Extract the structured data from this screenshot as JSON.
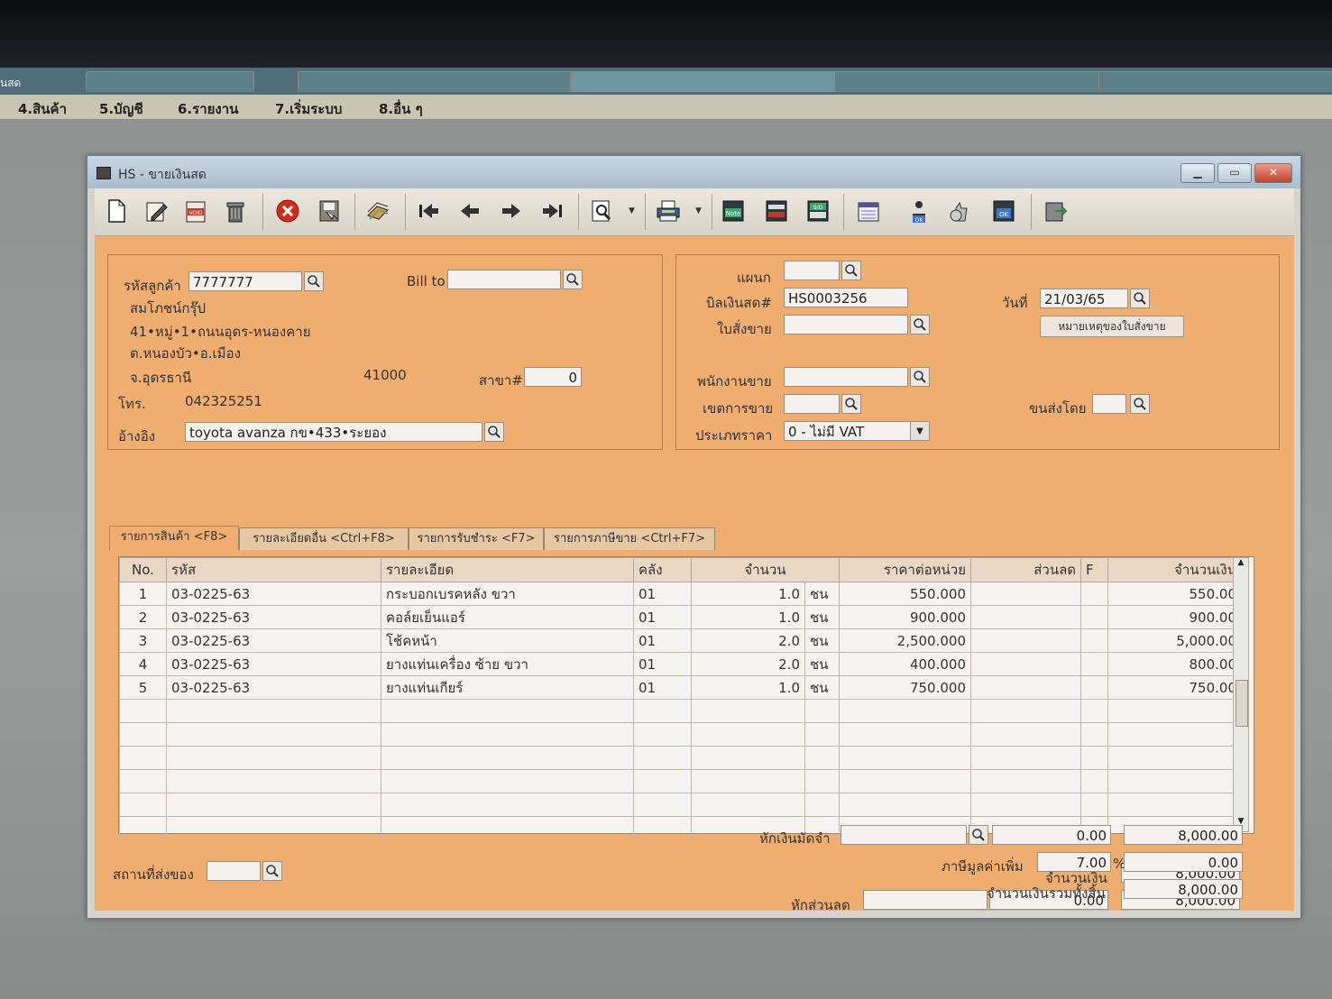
{
  "browser": {
    "left_label": "ันสด"
  },
  "menu": [
    "4.สินค้า",
    "5.บัญชี",
    "6.รายงาน",
    "7.เริ่มระบบ",
    "8.อื่น ๆ"
  ],
  "window": {
    "title": "HS - ขายเงินสด"
  },
  "customer": {
    "code_label": "รหัสลูกค้า",
    "code": "7777777",
    "bill_to_label": "Bill to",
    "bill_to": "",
    "name": "สมโภชน์กรุ๊ป",
    "addr1": "41•หมู่•1•ถนนอุดร-หนองคาย",
    "addr2": "ต.หนองบัว•อ.เมือง",
    "addr3": "จ.อุดรธานี",
    "postcode": "41000",
    "branch_label": "สาขา#",
    "branch": "0",
    "phone_label": "โทร.",
    "phone": "042325251",
    "ref_label": "อ้างอิง",
    "ref": "toyota avanza กข•433•ระยอง"
  },
  "doc": {
    "dept_label": "แผนก",
    "dept": "",
    "bill_label": "บิลเงินสด#",
    "bill": "HS0003256",
    "date_label": "วันที่",
    "date": "21/03/65",
    "order_label": "ใบสั่งขาย",
    "order": "",
    "order_note_button": "หมายเหตุของใบสั่งขาย",
    "salesman_label": "พนักงานขาย",
    "salesman": "",
    "area_label": "เขตการขาย",
    "area": "",
    "ship_label": "ขนส่งโดย",
    "ship": "",
    "price_type_label": "ประเภทราคา",
    "price_type": "0 - ไม่มี VAT"
  },
  "tabs": [
    "รายการสินค้า <F8>",
    "รายละเอียดอื่น <Ctrl+F8>",
    "รายการรับชำระ <F7>",
    "รายการภาษีขาย <Ctrl+F7>"
  ],
  "grid": {
    "headers": [
      "No.",
      "รหัส",
      "รายละเอียด",
      "คลัง",
      "จำนวน",
      "ราคาต่อหน่วย",
      "ส่วนลด",
      "F",
      "จำนวนเงิน"
    ],
    "rows": [
      {
        "no": "1",
        "code": "03-0225-63",
        "desc": "กระบอกเบรคหลัง ขวา",
        "wh": "01",
        "qty": "1.0",
        "unit": "ชน",
        "price": "550.000",
        "disc": "",
        "f": "",
        "amount": "550.00"
      },
      {
        "no": "2",
        "code": "03-0225-63",
        "desc": "คอล์ยเย็นแอร์",
        "wh": "01",
        "qty": "1.0",
        "unit": "ชน",
        "price": "900.000",
        "disc": "",
        "f": "",
        "amount": "900.00"
      },
      {
        "no": "3",
        "code": "03-0225-63",
        "desc": "โช้คหน้า",
        "wh": "01",
        "qty": "2.0",
        "unit": "ชน",
        "price": "2,500.000",
        "disc": "",
        "f": "",
        "amount": "5,000.00"
      },
      {
        "no": "4",
        "code": "03-0225-63",
        "desc": "ยางแท่นเครื่อง ซ้าย ขวา",
        "wh": "01",
        "qty": "2.0",
        "unit": "ชน",
        "price": "400.000",
        "disc": "",
        "f": "",
        "amount": "800.00"
      },
      {
        "no": "5",
        "code": "03-0225-63",
        "desc": "ยางแท่นเกียร์",
        "wh": "01",
        "qty": "1.0",
        "unit": "ชน",
        "price": "750.000",
        "disc": "",
        "f": "",
        "amount": "750.00"
      }
    ]
  },
  "footer": {
    "ship_place_label": "สถานที่ส่งของ",
    "ship_place": "",
    "amount_label": "จำนวนเงิน",
    "amount": "8,000.00",
    "discount_label": "หักส่วนลด",
    "discount_text": "",
    "discount": "0.00",
    "after_discount": "8,000.00",
    "deposit_label": "หักเงินมัดจำ",
    "deposit_text": "",
    "deposit": "0.00",
    "after_deposit": "8,000.00",
    "vat_label": "ภาษีมูลค่าเพิ่ม",
    "vat_rate": "7.00",
    "vat_pct": "%",
    "vat": "0.00",
    "total_label": "จำนวนเงินรวมทั้งสิ้น",
    "total": "8,000.00"
  }
}
